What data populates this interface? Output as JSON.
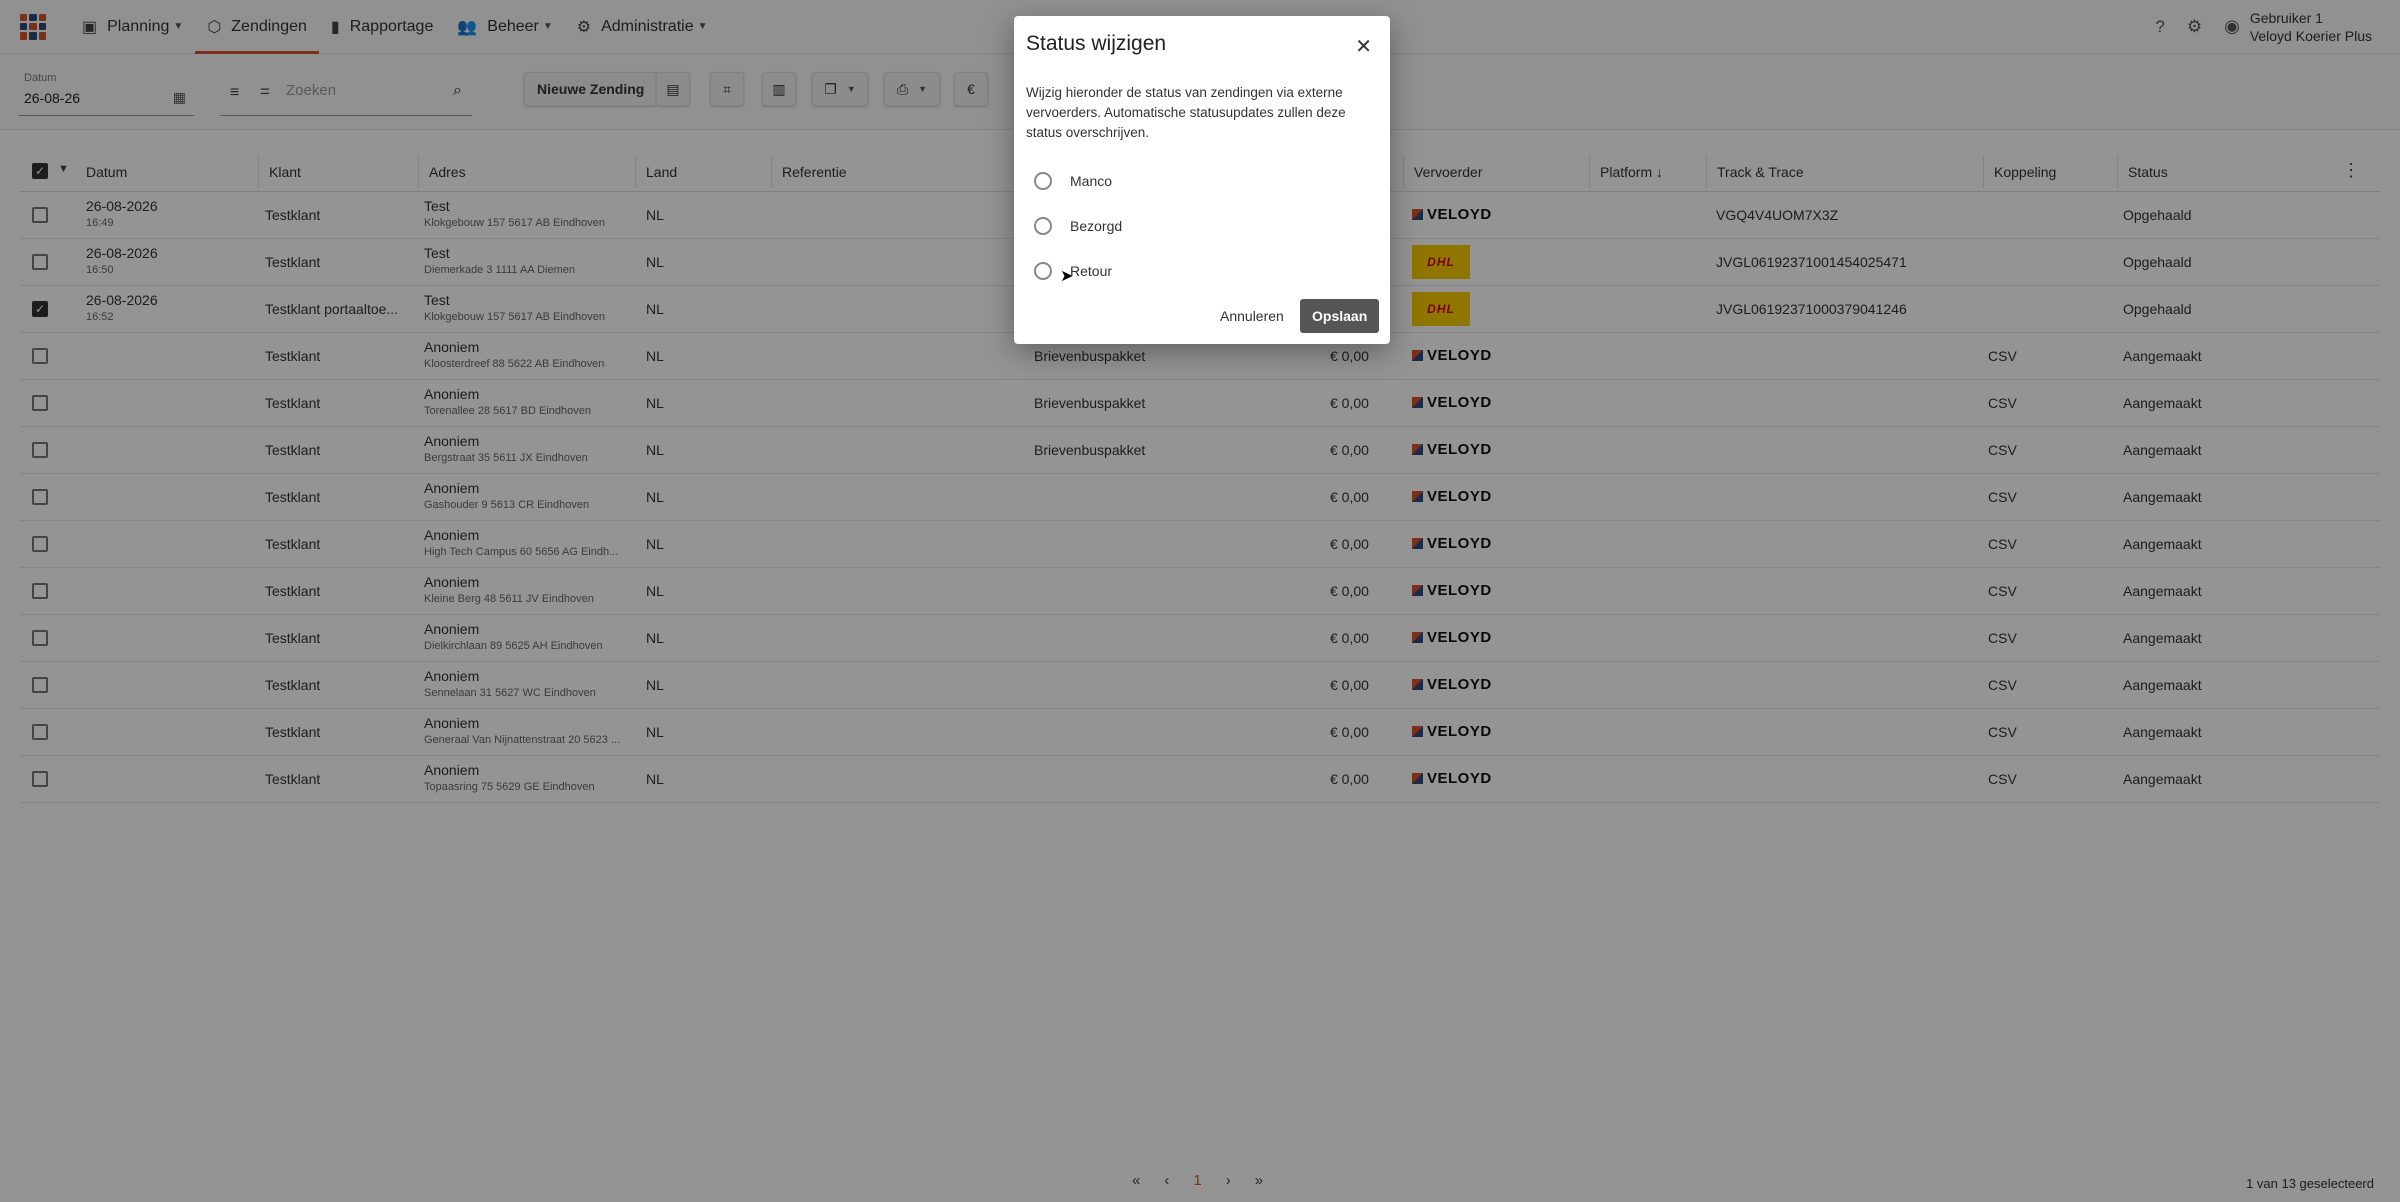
{
  "nav": {
    "items": [
      {
        "label": "Planning",
        "icon": "map-icon",
        "dropdown": true
      },
      {
        "label": "Zendingen",
        "icon": "package-icon",
        "active": true
      },
      {
        "label": "Rapportage",
        "icon": "bar-chart-icon"
      },
      {
        "label": "Beheer",
        "icon": "people-icon",
        "dropdown": true
      },
      {
        "label": "Administratie",
        "icon": "admin-icon",
        "dropdown": true
      }
    ],
    "user_name": "Gebruiker 1",
    "user_company": "Veloyd Koerier Plus"
  },
  "toolbar": {
    "date_label": "Datum",
    "date_value": "26-08-26",
    "search_placeholder": "Zoeken",
    "new_shipment_label": "Nieuwe Zending",
    "currency_symbol": "€"
  },
  "table": {
    "headers": {
      "datum": "Datum",
      "klant": "Klant",
      "adres": "Adres",
      "land": "Land",
      "referentie": "Referentie",
      "vervoerder": "Vervoerder",
      "platform": "Platform ↓",
      "track": "Track & Trace",
      "koppeling": "Koppeling",
      "status": "Status"
    },
    "rows": [
      {
        "checked": false,
        "date": "26-08-2026",
        "time": "16:49",
        "klant": "Testklant",
        "name": "Test",
        "address": "Klokgebouw 157 5617 AB Eindhoven",
        "land": "NL",
        "product": "",
        "price": "",
        "carrier": "veloyd",
        "carrier_label": "VELOYD",
        "track": "VGQ4V4UOM7X3Z",
        "koppeling": "",
        "status": "Opgehaald"
      },
      {
        "checked": false,
        "date": "26-08-2026",
        "time": "16:50",
        "klant": "Testklant",
        "name": "Test",
        "address": "Diemerkade 3 1111 AA Diemen",
        "land": "NL",
        "product": "",
        "price": "",
        "carrier": "dhl",
        "carrier_label": "DHL",
        "track": "JVGL06192371001454025471",
        "koppeling": "",
        "status": "Opgehaald"
      },
      {
        "checked": true,
        "date": "26-08-2026",
        "time": "16:52",
        "klant": "Testklant portaaltoe...",
        "name": "Test",
        "address": "Klokgebouw 157 5617 AB Eindhoven",
        "land": "NL",
        "product": "",
        "price": "",
        "carrier": "dhl",
        "carrier_label": "DHL",
        "track": "JVGL06192371000379041246",
        "koppeling": "",
        "status": "Opgehaald"
      },
      {
        "checked": false,
        "date": "",
        "time": "",
        "klant": "Testklant",
        "name": "Anoniem",
        "address": "Kloosterdreef 88 5622 AB Eindhoven",
        "land": "NL",
        "product": "Brievenbuspakket",
        "price": "€ 0,00",
        "carrier": "veloyd",
        "carrier_label": "VELOYD",
        "track": "",
        "koppeling": "CSV",
        "status": "Aangemaakt"
      },
      {
        "checked": false,
        "date": "",
        "time": "",
        "klant": "Testklant",
        "name": "Anoniem",
        "address": "Torenallee 28 5617 BD Eindhoven",
        "land": "NL",
        "product": "Brievenbuspakket",
        "price": "€ 0,00",
        "carrier": "veloyd",
        "carrier_label": "VELOYD",
        "track": "",
        "koppeling": "CSV",
        "status": "Aangemaakt"
      },
      {
        "checked": false,
        "date": "",
        "time": "",
        "klant": "Testklant",
        "name": "Anoniem",
        "address": "Bergstraat 35 5611 JX Eindhoven",
        "land": "NL",
        "product": "Brievenbuspakket",
        "price": "€ 0,00",
        "carrier": "veloyd",
        "carrier_label": "VELOYD",
        "track": "",
        "koppeling": "CSV",
        "status": "Aangemaakt"
      },
      {
        "checked": false,
        "date": "",
        "time": "",
        "klant": "Testklant",
        "name": "Anoniem",
        "address": "Gashouder 9 5613 CR Eindhoven",
        "land": "NL",
        "product": "",
        "price": "€ 0,00",
        "carrier": "veloyd",
        "carrier_label": "VELOYD",
        "track": "",
        "koppeling": "CSV",
        "status": "Aangemaakt"
      },
      {
        "checked": false,
        "date": "",
        "time": "",
        "klant": "Testklant",
        "name": "Anoniem",
        "address": "High Tech Campus 60 5656 AG Eindh...",
        "land": "NL",
        "product": "",
        "price": "€ 0,00",
        "carrier": "veloyd",
        "carrier_label": "VELOYD",
        "track": "",
        "koppeling": "CSV",
        "status": "Aangemaakt"
      },
      {
        "checked": false,
        "date": "",
        "time": "",
        "klant": "Testklant",
        "name": "Anoniem",
        "address": "Kleine Berg 48 5611 JV Eindhoven",
        "land": "NL",
        "product": "",
        "price": "€ 0,00",
        "carrier": "veloyd",
        "carrier_label": "VELOYD",
        "track": "",
        "koppeling": "CSV",
        "status": "Aangemaakt"
      },
      {
        "checked": false,
        "date": "",
        "time": "",
        "klant": "Testklant",
        "name": "Anoniem",
        "address": "Dielkirchlaan 89 5625 AH Eindhoven",
        "land": "NL",
        "product": "",
        "price": "€ 0,00",
        "carrier": "veloyd",
        "carrier_label": "VELOYD",
        "track": "",
        "koppeling": "CSV",
        "status": "Aangemaakt"
      },
      {
        "checked": false,
        "date": "",
        "time": "",
        "klant": "Testklant",
        "name": "Anoniem",
        "address": "Sennelaan 31 5627 WC Eindhoven",
        "land": "NL",
        "product": "",
        "price": "€ 0,00",
        "carrier": "veloyd",
        "carrier_label": "VELOYD",
        "track": "",
        "koppeling": "CSV",
        "status": "Aangemaakt"
      },
      {
        "checked": false,
        "date": "",
        "time": "",
        "klant": "Testklant",
        "name": "Anoniem",
        "address": "Generaal Van Nijnattenstraat 20 5623 ...",
        "land": "NL",
        "product": "",
        "price": "€ 0,00",
        "carrier": "veloyd",
        "carrier_label": "VELOYD",
        "track": "",
        "koppeling": "CSV",
        "status": "Aangemaakt"
      },
      {
        "checked": false,
        "date": "",
        "time": "",
        "klant": "Testklant",
        "name": "Anoniem",
        "address": "Topaasring 75 5629 GE Eindhoven",
        "land": "NL",
        "product": "",
        "price": "€ 0,00",
        "carrier": "veloyd",
        "carrier_label": "VELOYD",
        "track": "",
        "koppeling": "CSV",
        "status": "Aangemaakt"
      }
    ]
  },
  "pagination": {
    "current_page": "1",
    "selected_text": "1 van 13 geselecteerd"
  },
  "dialog": {
    "title": "Status wijzigen",
    "description": "Wijzig hieronder de status van zendingen via externe vervoerders. Automatische statusupdates zullen deze status overschrijven.",
    "options": [
      "Manco",
      "Bezorgd",
      "Retour"
    ],
    "cancel_label": "Annuleren",
    "save_label": "Opslaan"
  },
  "colors": {
    "accent": "#d3542b",
    "brand_blue": "#2d4a7a",
    "dhl_yellow": "#f7cc00",
    "dhl_red": "#d40511"
  }
}
